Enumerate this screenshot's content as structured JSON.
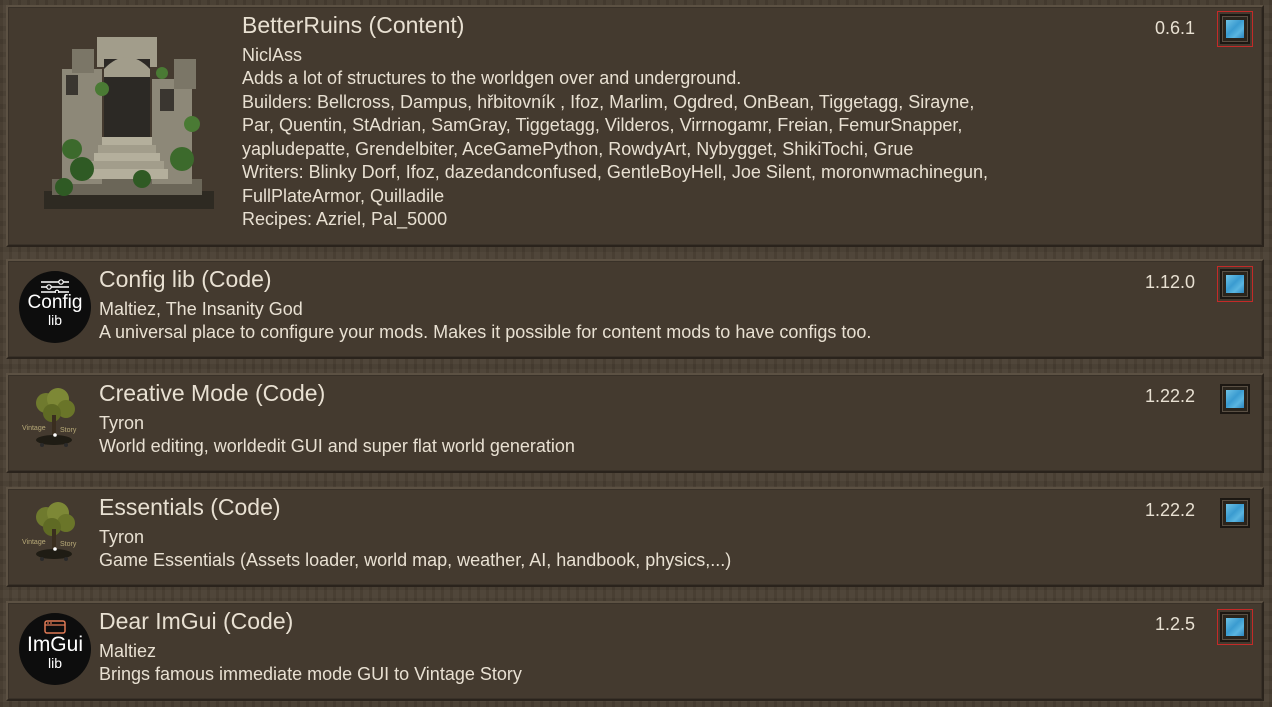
{
  "mods": [
    {
      "title": "BetterRuins (Content)",
      "author": "NiclAss",
      "description_lines": [
        "Adds a lot of structures to the worldgen over and underground.",
        "Builders: Bellcross, Dampus, hřbitovník , Ifoz, Marlim, Ogdred, OnBean, Tiggetagg, Sirayne,",
        "Par, Quentin, StAdrian, SamGray, Tiggetagg, Vilderos, Virrnogamr, Freian, FemurSnapper,",
        "yapludepatte, Grendelbiter, AceGamePython, RowdyArt, Nybygget, ShikiTochi, Grue",
        "Writers: Blinky Dorf, Ifoz, dazedandconfused, GentleBoyHell, Joe Silent, moronwmachinegun,",
        "FullPlateArmor, Quilladile",
        "Recipes: Azriel, Pal_5000"
      ],
      "version": "0.6.1",
      "enabled": true
    },
    {
      "title": "Config lib (Code)",
      "author": "Maltiez, The Insanity God",
      "description": "A universal place to configure your mods. Makes it possible for content mods to have configs too.",
      "version": "1.12.0",
      "enabled": true,
      "logo_text": "Config",
      "logo_sub": "lib"
    },
    {
      "title": "Creative Mode (Code)",
      "author": "Tyron",
      "description": "World editing, worldedit GUI and super flat world generation",
      "version": "1.22.2",
      "enabled": true,
      "logo_left": "Vintage",
      "logo_right": "Story"
    },
    {
      "title": "Essentials (Code)",
      "author": "Tyron",
      "description": "Game Essentials (Assets loader, world map, weather, AI, handbook, physics,...)",
      "version": "1.22.2",
      "enabled": true,
      "logo_left": "Vintage",
      "logo_right": "Story"
    },
    {
      "title": "Dear ImGui (Code)",
      "author": "Maltiez",
      "description": "Brings famous immediate mode GUI to Vintage Story",
      "version": "1.2.5",
      "enabled": true,
      "logo_text": "ImGui",
      "logo_sub": "lib"
    }
  ],
  "colors": {
    "background": "#4a3f33",
    "panel": "#443a2f",
    "checkbox_fill": "#3a9bd0",
    "highlight": "#c42a28"
  }
}
